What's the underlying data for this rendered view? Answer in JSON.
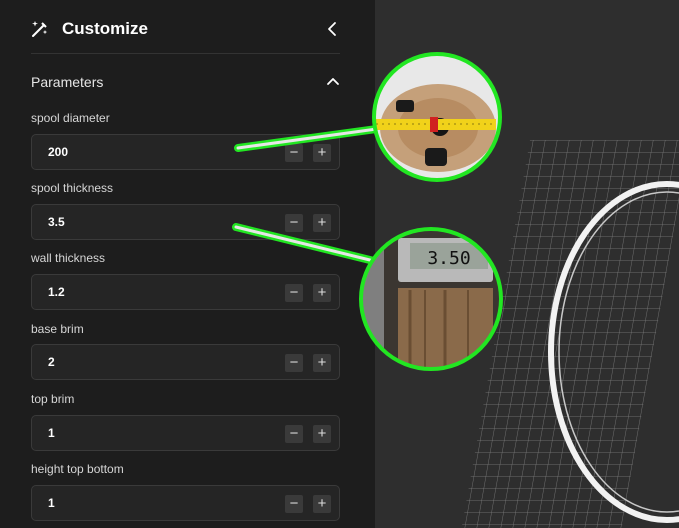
{
  "header": {
    "title": "Customize",
    "wand_icon": "magic-wand-icon",
    "collapse_icon": "chevron-left-icon"
  },
  "section": {
    "title": "Parameters",
    "toggle_icon": "chevron-up-icon"
  },
  "params": [
    {
      "label": "spool diameter",
      "value": "200"
    },
    {
      "label": "spool thickness",
      "value": "3.5"
    },
    {
      "label": "wall thickness",
      "value": "1.2"
    },
    {
      "label": "base brim",
      "value": "2"
    },
    {
      "label": "top brim",
      "value": "1"
    },
    {
      "label": "height top bottom",
      "value": "1"
    }
  ],
  "stepper": {
    "minus": "−",
    "plus": "+"
  },
  "callouts": {
    "caliper_reading": "3.50"
  },
  "colors": {
    "accent_green": "#22e622",
    "sidebar_bg": "#1d1d1d",
    "viewport_bg": "#2e2e2e"
  }
}
